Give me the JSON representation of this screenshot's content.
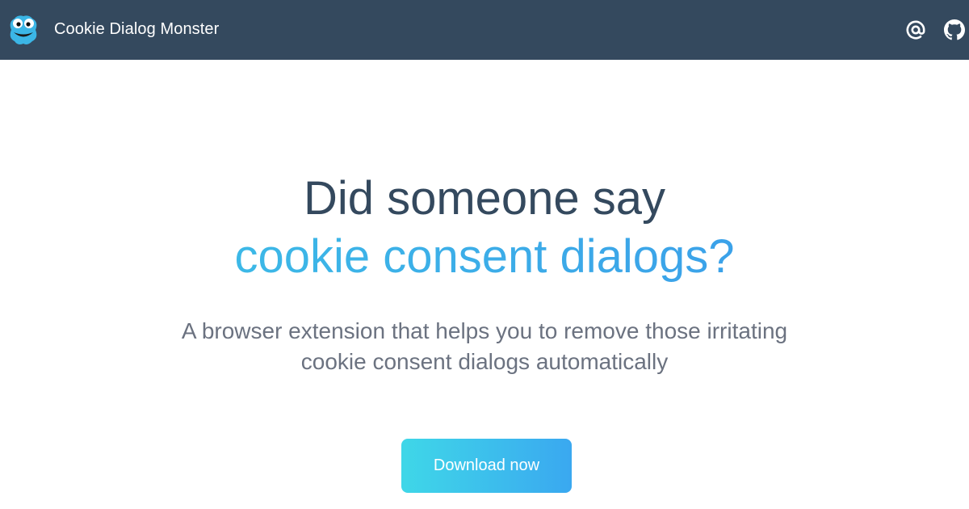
{
  "navbar": {
    "brand_name": "Cookie Dialog Monster",
    "logo_icon": "cookie-monster-logo",
    "links": [
      {
        "icon": "at-sign-icon"
      },
      {
        "icon": "github-icon"
      }
    ],
    "background": "#34495e"
  },
  "hero": {
    "title_line1": "Did someone say",
    "title_line2": "cookie consent dialogs?",
    "subtitle_line1": "A browser extension that helps you to remove those irritating",
    "subtitle_line2": "cookie consent dialogs automatically",
    "download_label": "Download now"
  },
  "colors": {
    "title": "#34495e",
    "accent_start": "#3cc3e6",
    "accent_end": "#3b97ea",
    "subtitle": "#6b7280"
  }
}
